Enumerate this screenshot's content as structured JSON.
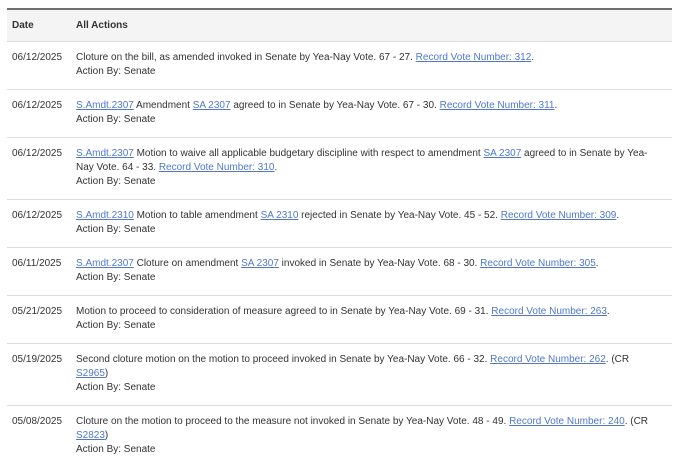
{
  "colors": {
    "link": "#5078c8",
    "text": "#333333",
    "header_background": "#f4f4f4",
    "top_border": "#6f6f6f",
    "row_divider": "#dcdcdc"
  },
  "table": {
    "columns": [
      "Date",
      "All Actions"
    ],
    "rows": [
      {
        "date": "06/12/2025",
        "parts": [
          {
            "t": "Cloture on the bill, as amended invoked in Senate by Yea-Nay Vote. 67 - 27. ",
            "link": false
          },
          {
            "t": "Record Vote Number: 312",
            "link": true
          },
          {
            "t": ".",
            "link": false
          }
        ],
        "action_by": "Action By: Senate"
      },
      {
        "date": "06/12/2025",
        "parts": [
          {
            "t": "S.Amdt.2307",
            "link": true
          },
          {
            "t": " Amendment ",
            "link": false
          },
          {
            "t": "SA 2307",
            "link": true
          },
          {
            "t": " agreed to in Senate by Yea-Nay Vote. 67 - 30. ",
            "link": false
          },
          {
            "t": "Record Vote Number: 311",
            "link": true
          },
          {
            "t": ".",
            "link": false
          }
        ],
        "action_by": "Action By: Senate"
      },
      {
        "date": "06/12/2025",
        "parts": [
          {
            "t": "S.Amdt.2307",
            "link": true
          },
          {
            "t": " Motion to waive all applicable budgetary discipline with respect to amendment ",
            "link": false
          },
          {
            "t": "SA 2307",
            "link": true
          },
          {
            "t": " agreed to in Senate by Yea-Nay Vote. 64 - 33. ",
            "link": false
          },
          {
            "t": "Record Vote Number: 310",
            "link": true
          },
          {
            "t": ".",
            "link": false
          }
        ],
        "action_by": "Action By: Senate"
      },
      {
        "date": "06/12/2025",
        "parts": [
          {
            "t": "S.Amdt.2310",
            "link": true
          },
          {
            "t": " Motion to table amendment ",
            "link": false
          },
          {
            "t": "SA 2310",
            "link": true
          },
          {
            "t": " rejected in Senate by Yea-Nay Vote. 45 - 52. ",
            "link": false
          },
          {
            "t": "Record Vote Number: 309",
            "link": true
          },
          {
            "t": ".",
            "link": false
          }
        ],
        "action_by": "Action By: Senate"
      },
      {
        "date": "06/11/2025",
        "parts": [
          {
            "t": "S.Amdt.2307",
            "link": true
          },
          {
            "t": " Cloture on amendment ",
            "link": false
          },
          {
            "t": "SA 2307",
            "link": true
          },
          {
            "t": " invoked in Senate by Yea-Nay Vote. 68 - 30. ",
            "link": false
          },
          {
            "t": "Record Vote Number: 305",
            "link": true
          },
          {
            "t": ".",
            "link": false
          }
        ],
        "action_by": "Action By: Senate"
      },
      {
        "date": "05/21/2025",
        "parts": [
          {
            "t": "Motion to proceed to consideration of measure agreed to in Senate by Yea-Nay Vote. 69 - 31. ",
            "link": false
          },
          {
            "t": "Record Vote Number: 263",
            "link": true
          },
          {
            "t": ".",
            "link": false
          }
        ],
        "action_by": "Action By: Senate"
      },
      {
        "date": "05/19/2025",
        "parts": [
          {
            "t": "Second cloture motion on the motion to proceed invoked in Senate by Yea-Nay Vote. 66 - 32. ",
            "link": false
          },
          {
            "t": "Record Vote Number: 262",
            "link": true
          },
          {
            "t": ". (CR ",
            "link": false
          },
          {
            "t": "S2965",
            "link": true
          },
          {
            "t": ")",
            "link": false
          }
        ],
        "action_by": "Action By: Senate"
      },
      {
        "date": "05/08/2025",
        "parts": [
          {
            "t": "Cloture on the motion to proceed to the measure not invoked in Senate by Yea-Nay Vote. 48 - 49. ",
            "link": false
          },
          {
            "t": "Record Vote Number: 240",
            "link": true
          },
          {
            "t": ". (CR ",
            "link": false
          },
          {
            "t": "S2823",
            "link": true
          },
          {
            "t": ")",
            "link": false
          }
        ],
        "action_by": "Action By: Senate"
      }
    ]
  }
}
